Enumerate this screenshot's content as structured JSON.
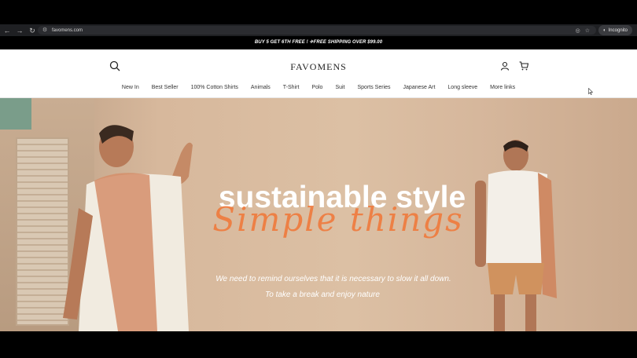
{
  "browser": {
    "url": "favomens.com",
    "incognito_label": "Incognito"
  },
  "promo": {
    "text": "BUY 5 GET 6TH FREE ! ✈FREE SHIPPING OVER $99.00"
  },
  "header": {
    "logo": "FAVOMENS"
  },
  "menu": {
    "items": [
      "New In",
      "Best Seller",
      "100% Cotton Shirts",
      "Animals",
      "T-Shirt",
      "Polo",
      "Suit",
      "Sports Series",
      "Japanese Art",
      "Long sleeve",
      "More links"
    ]
  },
  "hero": {
    "headline": "sustainable style",
    "script": "Simple things",
    "sub1": "We need to remind ourselves that it is necessary to slow it all down.",
    "sub2": "To take a break and enjoy nature"
  },
  "colors": {
    "accent_orange": "#f07a3c"
  }
}
